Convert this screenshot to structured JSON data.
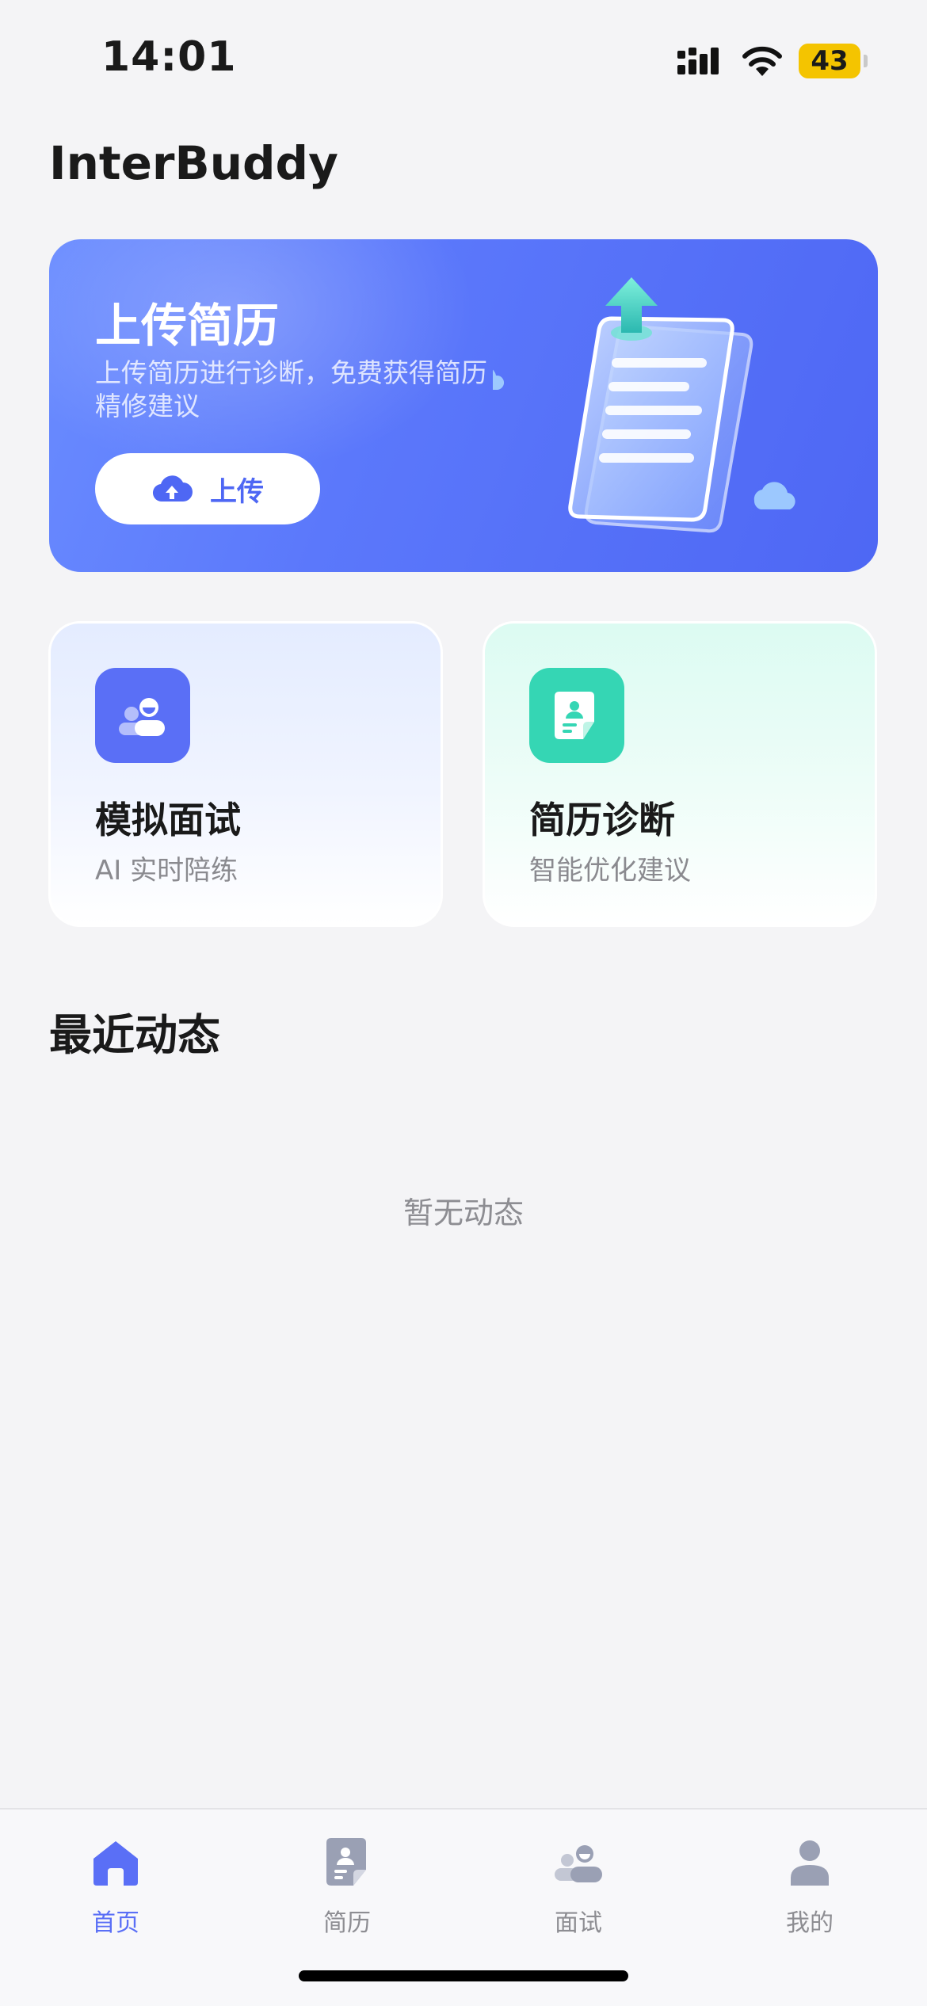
{
  "status_bar": {
    "time": "14:01",
    "battery": "43"
  },
  "app": {
    "title": "InterBuddy"
  },
  "upload_banner": {
    "title": "上传简历",
    "description": "上传简历进行诊断，免费获得简历精修建议",
    "button_label": "上传"
  },
  "feature_cards": [
    {
      "title": "模拟面试",
      "subtitle": "AI 实时陪练",
      "icon": "interview-icon"
    },
    {
      "title": "简历诊断",
      "subtitle": "智能优化建议",
      "icon": "resume-icon"
    }
  ],
  "recent": {
    "title": "最近动态",
    "empty_text": "暂无动态"
  },
  "tab_bar": {
    "items": [
      {
        "label": "首页",
        "icon": "home-icon",
        "active": true
      },
      {
        "label": "简历",
        "icon": "resume-icon",
        "active": false
      },
      {
        "label": "面试",
        "icon": "interview-icon",
        "active": false
      },
      {
        "label": "我的",
        "icon": "profile-icon",
        "active": false
      }
    ]
  },
  "colors": {
    "accent": "#5a6ff6",
    "banner_gradient_start": "#6a8cff",
    "banner_gradient_end": "#4e67f4",
    "teal": "#35d6b4",
    "battery": "#f4c400",
    "background": "#f4f4f6"
  }
}
